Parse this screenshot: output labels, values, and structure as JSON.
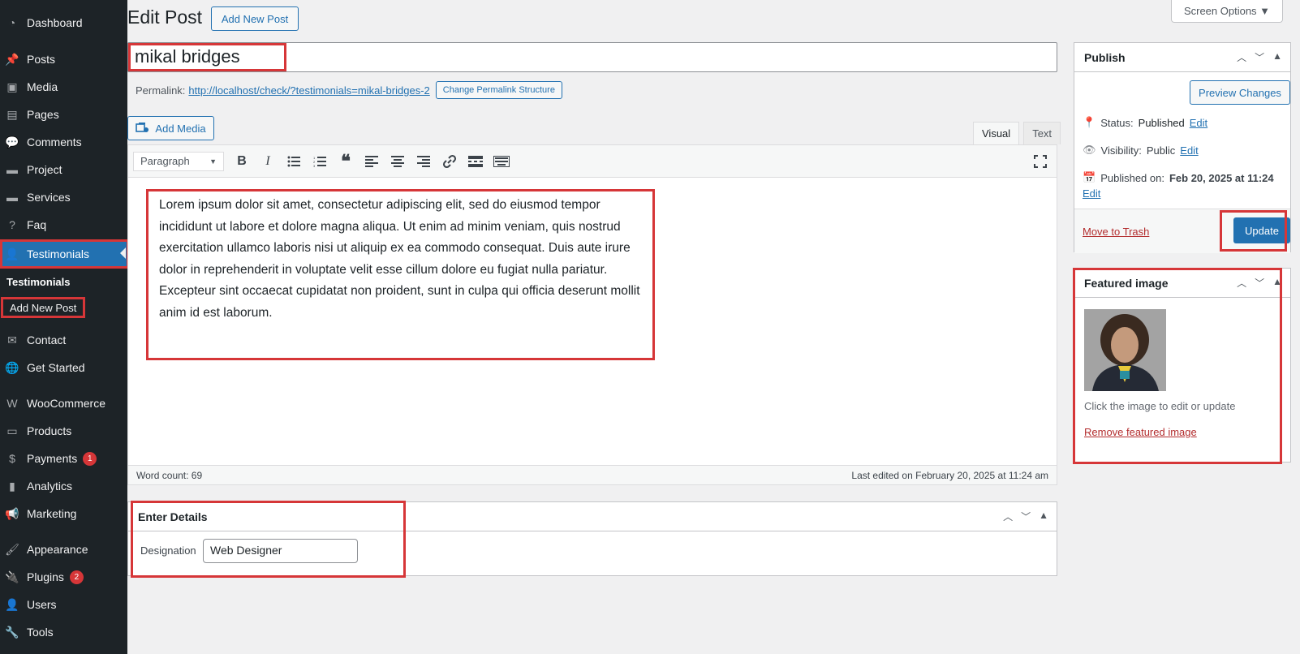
{
  "sidebar": {
    "items": [
      {
        "label": "Dashboard",
        "icon": "dashboard-icon"
      },
      {
        "label": "Posts",
        "icon": "pin-icon"
      },
      {
        "label": "Media",
        "icon": "media-icon"
      },
      {
        "label": "Pages",
        "icon": "pages-icon"
      },
      {
        "label": "Comments",
        "icon": "comments-icon"
      },
      {
        "label": "Project",
        "icon": "folder-icon"
      },
      {
        "label": "Services",
        "icon": "folder-icon"
      },
      {
        "label": "Faq",
        "icon": "help-icon"
      },
      {
        "label": "Testimonials",
        "icon": "user-icon"
      },
      {
        "label": "Contact",
        "icon": "mail-icon"
      },
      {
        "label": "Get Started",
        "icon": "globe-icon"
      },
      {
        "label": "WooCommerce",
        "icon": "woo-icon"
      },
      {
        "label": "Products",
        "icon": "archive-icon"
      },
      {
        "label": "Payments",
        "icon": "payments-icon",
        "badge": "1"
      },
      {
        "label": "Analytics",
        "icon": "chart-icon"
      },
      {
        "label": "Marketing",
        "icon": "megaphone-icon"
      },
      {
        "label": "Appearance",
        "icon": "brush-icon"
      },
      {
        "label": "Plugins",
        "icon": "plugin-icon",
        "badge": "2"
      },
      {
        "label": "Users",
        "icon": "users-icon"
      },
      {
        "label": "Tools",
        "icon": "wrench-icon"
      }
    ],
    "submenu_title": "Testimonials",
    "submenu_item": "Add New Post"
  },
  "header": {
    "title": "Edit Post",
    "add_new": "Add New Post",
    "screen_options": "Screen Options ▼"
  },
  "post": {
    "title": "mikal bridges",
    "permalink_label": "Permalink:",
    "permalink_url": "http://localhost/check/?testimonials=mikal-bridges-2",
    "change_permalink": "Change Permalink Structure",
    "add_media": "Add Media",
    "tab_visual": "Visual",
    "tab_text": "Text",
    "format": "Paragraph",
    "content": "Lorem ipsum dolor sit amet, consectetur adipiscing elit, sed do eiusmod tempor incididunt ut labore et dolore magna aliqua. Ut enim ad minim veniam, quis nostrud exercitation ullamco laboris nisi ut aliquip ex ea commodo consequat. Duis aute irure dolor in reprehenderit in voluptate velit esse cillum dolore eu fugiat nulla pariatur. Excepteur sint occaecat cupidatat non proident, sunt in culpa qui officia deserunt mollit anim id est laborum.",
    "word_count": "Word count: 69",
    "last_edited": "Last edited on February 20, 2025 at 11:24 am"
  },
  "details": {
    "title": "Enter Details",
    "designation_label": "Designation",
    "designation_value": "Web Designer"
  },
  "publish": {
    "title": "Publish",
    "preview": "Preview Changes",
    "status_label": "Status:",
    "status_value": "Published",
    "visibility_label": "Visibility:",
    "visibility_value": "Public",
    "published_label": "Published on:",
    "published_value": "Feb 20, 2025 at 11:24",
    "edit": "Edit",
    "trash": "Move to Trash",
    "update": "Update"
  },
  "featured": {
    "title": "Featured image",
    "hint": "Click the image to edit or update",
    "remove": "Remove featured image"
  },
  "colors": {
    "accent": "#2271b1",
    "sidebar": "#1d2327",
    "highlight": "#d63638"
  }
}
